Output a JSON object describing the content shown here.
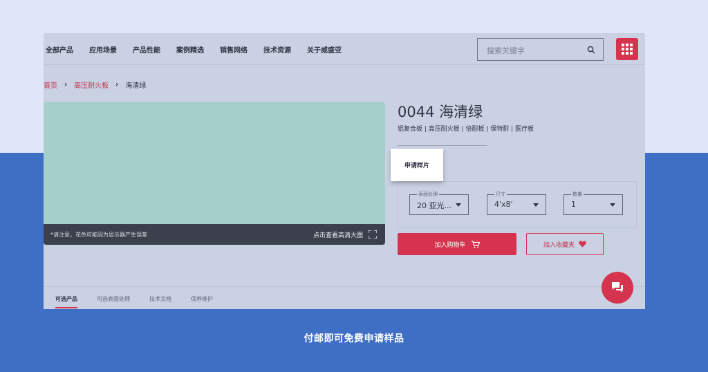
{
  "nav": {
    "items": [
      "全部产品",
      "应用场景",
      "产品性能",
      "案例精选",
      "销售网络",
      "技术资源",
      "关于威盛亚"
    ],
    "search_placeholder": "搜索关键字"
  },
  "breadcrumb": {
    "home": "首页",
    "category": "高压耐火板",
    "current": "海清绿"
  },
  "product": {
    "title": "0044 海清绿",
    "tags": "铝复合板 | 高压耐火板 | 倍耐板 | 保特耐 | 医疗板",
    "swatch_color": "#a5cfcb",
    "note": "*请注意，花色可能因为显示器产生误差",
    "view_hd": "点击查看高清大图",
    "sample_button": "申请样片"
  },
  "options": {
    "surface": {
      "label": "表面处理",
      "value": "20 亚光..."
    },
    "size": {
      "label": "尺寸",
      "value": "4'x8'"
    },
    "quantity": {
      "label": "数量",
      "value": "1"
    }
  },
  "actions": {
    "cart": "加入购物车",
    "favorite": "加入收藏夹"
  },
  "tabs": [
    "可选产品",
    "可选表面处理",
    "技术文档",
    "保养维护"
  ],
  "caption": "付邮即可免费申请样品",
  "colors": {
    "accent": "#d6334e",
    "panel": "#c9d1e3",
    "background": "#3f6fc4"
  }
}
